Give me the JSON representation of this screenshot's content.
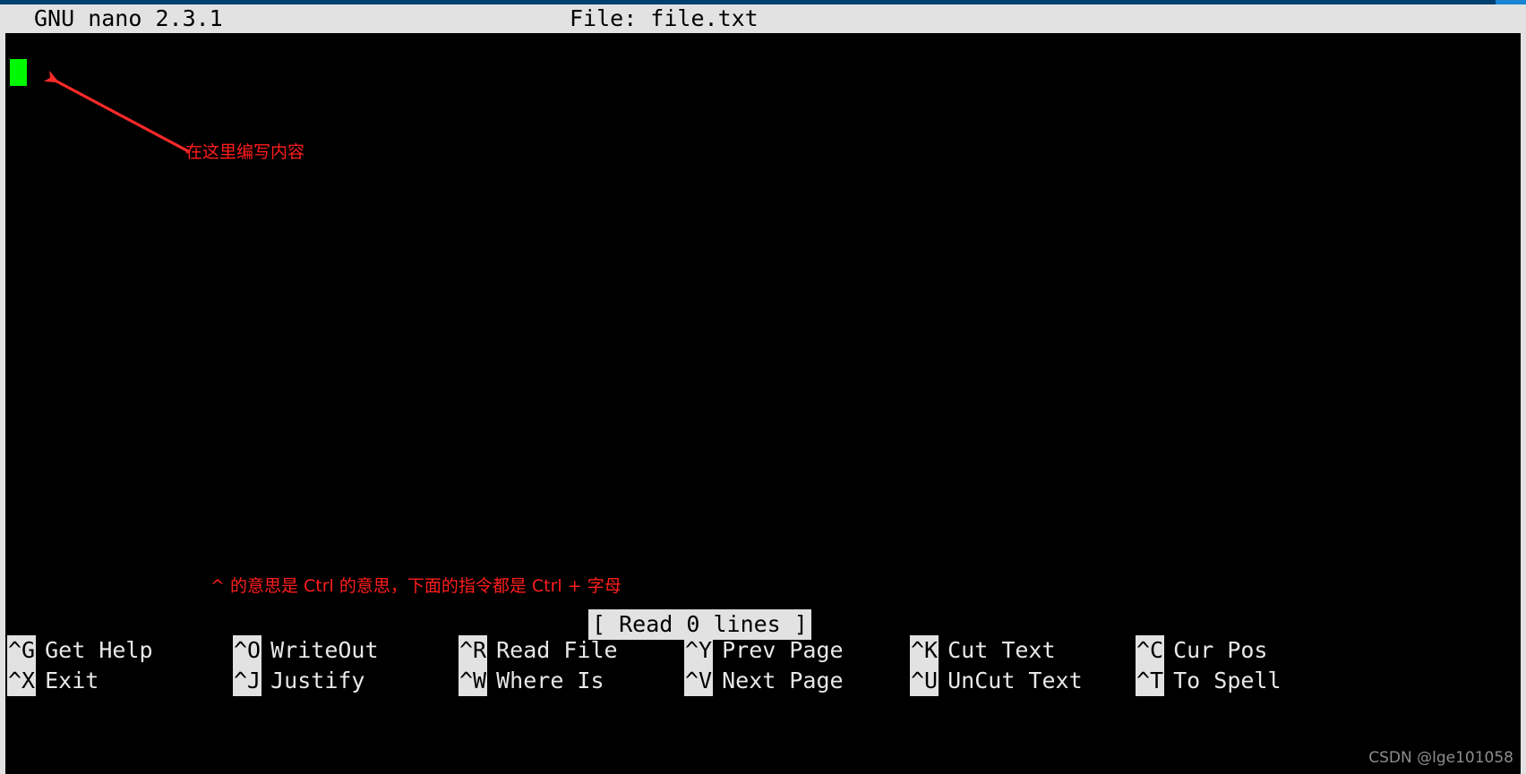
{
  "window": {
    "accent_color": "#00406e",
    "border_color": "#e2e2e2"
  },
  "titlebar": {
    "app_title": "GNU nano 2.3.1",
    "file_title": "File: file.txt"
  },
  "editor": {
    "cursor_color": "#00f900",
    "background": "#000000",
    "content": ""
  },
  "annotations": {
    "arrow_color": "#ff1d1d",
    "cursor_note": "在这里编写内容",
    "ctrl_note": "^ 的意思是 Ctrl 的意思，下面的指令都是 Ctrl + 字母"
  },
  "status": {
    "message": "[ Read 0 lines ]"
  },
  "shortcuts": {
    "columns": [
      {
        "rows": [
          {
            "key": "^G",
            "label": "Get Help"
          },
          {
            "key": "^X",
            "label": "Exit"
          }
        ]
      },
      {
        "rows": [
          {
            "key": "^O",
            "label": "WriteOut"
          },
          {
            "key": "^J",
            "label": "Justify"
          }
        ]
      },
      {
        "rows": [
          {
            "key": "^R",
            "label": "Read File"
          },
          {
            "key": "^W",
            "label": "Where Is"
          }
        ]
      },
      {
        "rows": [
          {
            "key": "^Y",
            "label": "Prev Page"
          },
          {
            "key": "^V",
            "label": "Next Page"
          }
        ]
      },
      {
        "rows": [
          {
            "key": "^K",
            "label": "Cut Text"
          },
          {
            "key": "^U",
            "label": "UnCut Text"
          }
        ]
      },
      {
        "rows": [
          {
            "key": "^C",
            "label": "Cur Pos"
          },
          {
            "key": "^T",
            "label": "To Spell"
          }
        ]
      }
    ]
  },
  "watermark": {
    "text": "CSDN @lge101058"
  }
}
